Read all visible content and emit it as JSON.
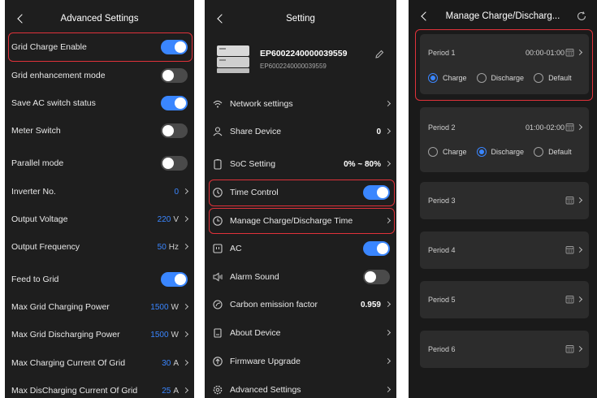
{
  "advanced": {
    "title": "Advanced Settings",
    "rows": [
      {
        "label": "Grid Charge Enable",
        "toggle": "on"
      },
      {
        "label": "Grid enhancement mode",
        "toggle": "off"
      },
      {
        "label": "Save AC switch status",
        "toggle": "on"
      },
      {
        "label": "Meter Switch",
        "toggle": "off"
      },
      {
        "label": "Parallel mode",
        "toggle": "off"
      },
      {
        "label": "Inverter No.",
        "value": "0",
        "unit": ""
      },
      {
        "label": "Output Voltage",
        "value": "220",
        "unit": "V"
      },
      {
        "label": "Output Frequency",
        "value": "50",
        "unit": "Hz"
      },
      {
        "label": "Feed to Grid",
        "toggle": "on"
      },
      {
        "label": "Max Grid Charging Power",
        "value": "1500",
        "unit": "W"
      },
      {
        "label": "Max Grid Discharging Power",
        "value": "1500",
        "unit": "W"
      },
      {
        "label": "Max Charging Current Of Grid",
        "value": "30",
        "unit": "A"
      },
      {
        "label": "Max DisCharging Current Of Grid",
        "value": "25",
        "unit": "A"
      }
    ]
  },
  "setting": {
    "title": "Setting",
    "device_name": "EP6002240000039559",
    "device_sub": "EP6002240000039559",
    "rows": [
      {
        "label": "Network settings",
        "icon": "network-icon"
      },
      {
        "label": "Share Device",
        "icon": "share-user-icon",
        "value": "0"
      },
      {
        "label": "SoC Setting",
        "icon": "battery-icon",
        "value": "0% ~ 80%"
      },
      {
        "label": "Time Control",
        "icon": "clock-icon",
        "toggle": "on"
      },
      {
        "label": "Manage Charge/Discharge Time",
        "icon": "clock-charge-icon"
      },
      {
        "label": "AC",
        "icon": "ac-outlet-icon",
        "toggle": "on"
      },
      {
        "label": "Alarm Sound",
        "icon": "speaker-icon",
        "toggle": "off"
      },
      {
        "label": "Carbon emission factor",
        "icon": "leaf-icon",
        "value": "0.959"
      },
      {
        "label": "About Device",
        "icon": "document-icon"
      },
      {
        "label": "Firmware Upgrade",
        "icon": "upgrade-icon"
      },
      {
        "label": "Advanced Settings",
        "icon": "gear-icon"
      }
    ]
  },
  "manage": {
    "title": "Manage Charge/Discharg...",
    "radio_labels": [
      "Charge",
      "Discharge",
      "Default"
    ],
    "periods": [
      {
        "label": "Period 1",
        "time": "00:00-01:00",
        "selected": "Charge"
      },
      {
        "label": "Period 2",
        "time": "01:00-02:00",
        "selected": "Discharge"
      },
      {
        "label": "Period 3",
        "time": ""
      },
      {
        "label": "Period 4",
        "time": ""
      },
      {
        "label": "Period 5",
        "time": ""
      },
      {
        "label": "Period 6",
        "time": ""
      }
    ]
  },
  "colors": {
    "accent": "#3a86ff",
    "highlight": "#e0323a",
    "panel_bg": "#1e1e1e",
    "card_bg": "#2c2c2c"
  }
}
